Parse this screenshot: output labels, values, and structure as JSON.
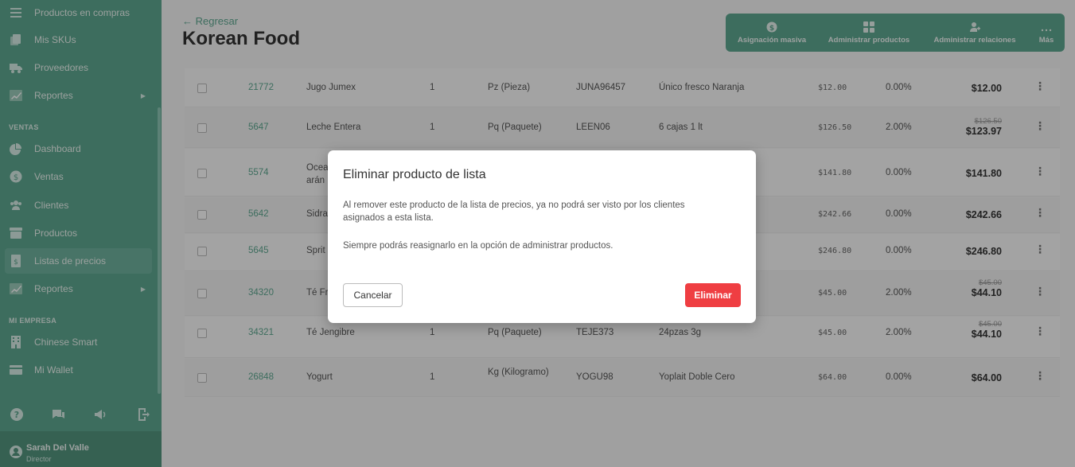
{
  "sidebar": {
    "items_top": [
      {
        "label": "Productos en compras",
        "icon": "list-icon"
      },
      {
        "label": "Mis SKUs",
        "icon": "copy-icon"
      },
      {
        "label": "Proveedores",
        "icon": "truck-icon"
      },
      {
        "label": "Reportes",
        "icon": "chart-icon",
        "arrow": "▶"
      }
    ],
    "section_ventas": "VENTAS",
    "items_ventas": [
      {
        "label": "Dashboard",
        "icon": "pie-chart-icon"
      },
      {
        "label": "Ventas",
        "icon": "dollar-icon"
      },
      {
        "label": "Clientes",
        "icon": "users-icon"
      },
      {
        "label": "Productos",
        "icon": "archive-icon"
      },
      {
        "label": "Listas de precios",
        "icon": "price-list-icon",
        "active": true
      },
      {
        "label": "Reportes",
        "icon": "chart-icon",
        "arrow": "▶"
      }
    ],
    "section_empresa": "MI EMPRESA",
    "items_empresa": [
      {
        "label": "Chinese Smart",
        "icon": "building-icon"
      },
      {
        "label": "Mi Wallet",
        "icon": "wallet-icon"
      }
    ],
    "user": {
      "name": "Sarah Del Valle",
      "role": "Director"
    }
  },
  "header": {
    "back_label": "← Regresar",
    "title": "Korean Food",
    "actions": [
      {
        "label": "Asignación masiva",
        "icon": "dollar-icon"
      },
      {
        "label": "Administrar productos",
        "icon": "grid-icon"
      },
      {
        "label": "Administrar relaciones",
        "icon": "user-link-icon"
      },
      {
        "label": "Más",
        "icon": "more-icon"
      }
    ]
  },
  "table": {
    "rows": [
      {
        "code": "21772",
        "name": "Jugo Jumex",
        "qty": "1",
        "unit": "Pz (Pieza)",
        "sku": "JUNA96457",
        "desc": "Único fresco Naranja",
        "base": "$12.00",
        "discount": "0.00%",
        "old_price": "",
        "price": "$12.00"
      },
      {
        "code": "5647",
        "name": "Leche Entera",
        "qty": "1",
        "unit": "Pq (Paquete)",
        "sku": "LEEN06",
        "desc": "6 cajas 1 lt",
        "base": "$126.50",
        "discount": "2.00%",
        "old_price": "$126.50",
        "price": "$123.97"
      },
      {
        "code": "5574",
        "name": "Ocea arán",
        "qty": "",
        "unit": "",
        "sku": "",
        "desc": "",
        "base": "$141.80",
        "discount": "0.00%",
        "old_price": "",
        "price": "$141.80"
      },
      {
        "code": "5642",
        "name": "Sidra",
        "qty": "",
        "unit": "",
        "sku": "",
        "desc": "",
        "base": "$242.66",
        "discount": "0.00%",
        "old_price": "",
        "price": "$242.66"
      },
      {
        "code": "5645",
        "name": "Sprit",
        "qty": "",
        "unit": "",
        "sku": "",
        "desc": "",
        "base": "$246.80",
        "discount": "0.00%",
        "old_price": "",
        "price": "$246.80"
      },
      {
        "code": "34320",
        "name": "Té Fr",
        "qty": "",
        "unit": "",
        "sku": "",
        "desc": "",
        "base": "$45.00",
        "discount": "2.00%",
        "old_price": "$45.00",
        "price": "$44.10"
      },
      {
        "code": "34321",
        "name": "Té Jengibre",
        "qty": "1",
        "unit": "Pq (Paquete)",
        "sku": "TEJE373",
        "desc": "24pzas 3g",
        "base": "$45.00",
        "discount": "2.00%",
        "old_price": "$45.00",
        "price": "$44.10"
      },
      {
        "code": "26848",
        "name": "Yogurt",
        "qty": "1",
        "unit": "Kg (Kilogramo)",
        "sku": "YOGU98",
        "desc": "Yoplait Doble Cero",
        "base": "$64.00",
        "discount": "0.00%",
        "old_price": "",
        "price": "$64.00"
      }
    ]
  },
  "modal": {
    "title": "Eliminar producto de lista",
    "text1": "Al remover este producto de la lista de precios, ya no podrá ser visto por los clientes asignados a esta lista.",
    "text2": "Siempre podrás reasignarlo en la opción de administrar productos.",
    "cancel_label": "Cancelar",
    "delete_label": "Eliminar"
  },
  "colors": {
    "brand": "#5ea891",
    "danger": "#ef3e42"
  }
}
